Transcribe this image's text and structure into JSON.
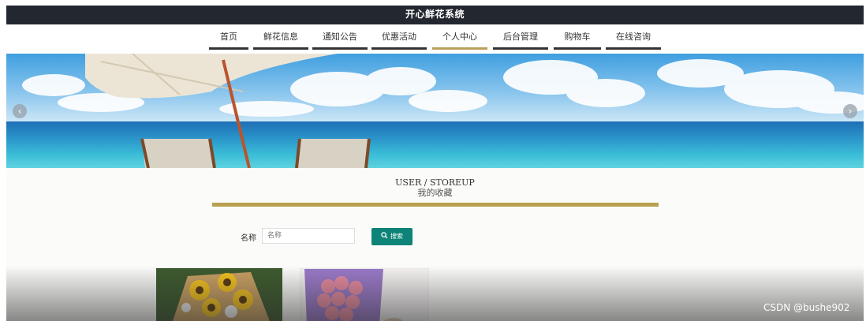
{
  "app": {
    "title": "开心鲜花系统"
  },
  "nav": {
    "items": [
      {
        "label": "首页",
        "active": false
      },
      {
        "label": "鲜花信息",
        "active": false
      },
      {
        "label": "通知公告",
        "active": false
      },
      {
        "label": "优惠活动",
        "active": false
      },
      {
        "label": "个人中心",
        "active": true
      },
      {
        "label": "后台管理",
        "active": false
      },
      {
        "label": "购物车",
        "active": false
      },
      {
        "label": "在线咨询",
        "active": false
      }
    ]
  },
  "banner": {
    "prev_icon": "chevron-left-icon",
    "next_icon": "chevron-right-icon",
    "prev_glyph": "‹",
    "next_glyph": "›"
  },
  "section": {
    "title_en": "USER / STOREUP",
    "title_zh": "我的收藏"
  },
  "search": {
    "label": "名称",
    "placeholder": "名称",
    "value": "",
    "button_label": "搜索",
    "button_icon": "search-icon"
  },
  "watermark": {
    "text": "CSDN @bushe902"
  },
  "colors": {
    "topbar": "#23272f",
    "accent_gold": "#b9a050",
    "button_teal": "#0e8377"
  }
}
